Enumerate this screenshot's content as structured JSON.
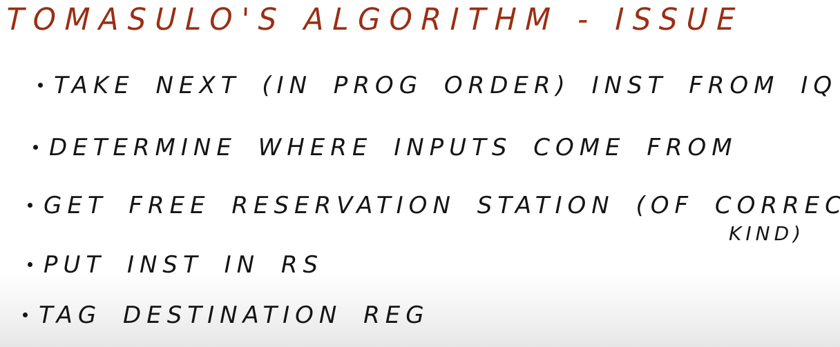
{
  "slide": {
    "title": "TOMASULO'S ALGORITHM - ISSUE",
    "bullets": [
      "TAKE NEXT (IN PROG ORDER) INST FROM IQ",
      "DETERMINE WHERE INPUTS COME FROM",
      "GET FREE RESERVATION STATION (OF CORRECT",
      "PUT INST IN RS",
      "TAG DESTINATION REG"
    ],
    "bullet3_continuation": "KIND)"
  }
}
